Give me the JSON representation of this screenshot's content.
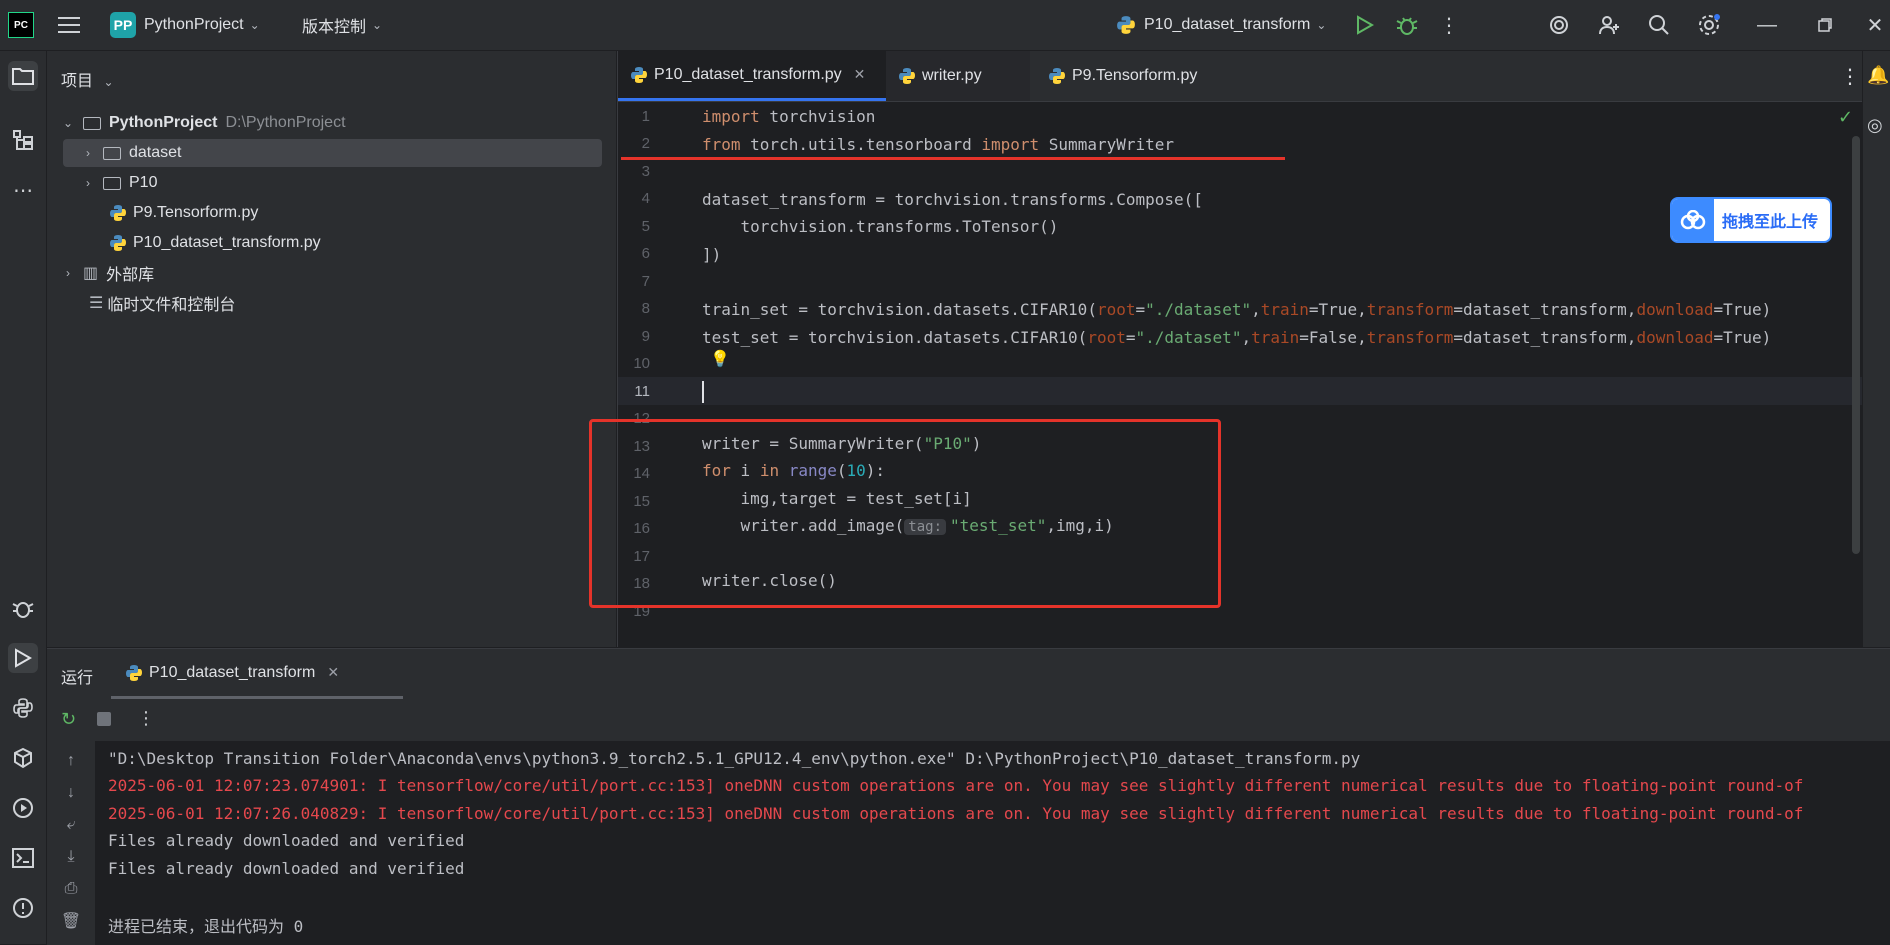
{
  "titlebar": {
    "project_badge": "PP",
    "project_name": "PythonProject",
    "vcs_label": "版本控制",
    "run_config": "P10_dataset_transform"
  },
  "project_panel": {
    "header": "项目",
    "root_name": "PythonProject",
    "root_path": "D:\\PythonProject",
    "items": [
      {
        "label": "dataset",
        "kind": "folder"
      },
      {
        "label": "P10",
        "kind": "folder"
      },
      {
        "label": "P9.Tensorform.py",
        "kind": "python"
      },
      {
        "label": "P10_dataset_transform.py",
        "kind": "python"
      }
    ],
    "external_libs": "外部库",
    "scratches": "临时文件和控制台"
  },
  "editor": {
    "tabs": [
      {
        "label": "P10_dataset_transform.py",
        "active": true
      },
      {
        "label": "writer.py",
        "active": false
      },
      {
        "label": "P9.Tensorform.py",
        "active": false
      }
    ],
    "line_numbers": [
      "1",
      "2",
      "3",
      "4",
      "5",
      "6",
      "7",
      "8",
      "9",
      "10",
      "11",
      "12",
      "13",
      "14",
      "15",
      "16",
      "17",
      "18",
      "19"
    ],
    "current_line": "11",
    "code": {
      "l1_kw": "import",
      "l1_rest": " torchvision",
      "l2_kw1": "from",
      "l2_mid": " torch.utils.tensorboard ",
      "l2_kw2": "import",
      "l2_rest": " SummaryWriter",
      "l4": "dataset_transform = torchvision.transforms.Compose([",
      "l5": "    torchvision.transforms.ToTensor()",
      "l6": "])",
      "l8_a": "train_set = torchvision.datasets.CIFAR10(",
      "l8_p1": "root",
      "l8_s1": "\"./dataset\"",
      "l8_c1": ",",
      "l8_p2": "train",
      "l8_v2": "=True,",
      "l8_p3": "transform",
      "l8_v3": "=dataset_transform,",
      "l8_p4": "download",
      "l8_v4": "=True)",
      "l9_a": "test_set = torchvision.datasets.CIFAR10(",
      "l9_p1": "root",
      "l9_s1": "\"./dataset\"",
      "l9_c1": ",",
      "l9_p2": "train",
      "l9_v2": "=False,",
      "l9_p3": "transform",
      "l9_v3": "=dataset_transform,",
      "l9_p4": "download",
      "l9_v4": "=True)",
      "l13_a": "writer = SummaryWriter(",
      "l13_s": "\"P10\"",
      "l13_b": ")",
      "l14_kw1": "for",
      "l14_mid": " i ",
      "l14_kw2": "in",
      "l14_sp": " ",
      "l14_bi": "range",
      "l14_lp": "(",
      "l14_num": "10",
      "l14_rp": "):",
      "l15": "    img,target = test_set[i]",
      "l16_a": "    writer.add_image(",
      "l16_hint": "tag:",
      "l16_s": "\"test_set\"",
      "l16_b": ",img,i)",
      "l18": "writer.close()"
    }
  },
  "upload_widget": {
    "label": "拖拽至此上传"
  },
  "run_panel": {
    "tab_run": "运行",
    "tab_config": "P10_dataset_transform",
    "lines": [
      {
        "text": "\"D:\\Desktop Transition Folder\\Anaconda\\envs\\python3.9_torch2.5.1_GPU12.4_env\\python.exe\" D:\\PythonProject\\P10_dataset_transform.py",
        "error": false
      },
      {
        "text": "2025-06-01 12:07:23.074901: I tensorflow/core/util/port.cc:153] oneDNN custom operations are on. You may see slightly different numerical results due to floating-point round-of",
        "error": true
      },
      {
        "text": "2025-06-01 12:07:26.040829: I tensorflow/core/util/port.cc:153] oneDNN custom operations are on. You may see slightly different numerical results due to floating-point round-of",
        "error": true
      },
      {
        "text": "Files already downloaded and verified",
        "error": false
      },
      {
        "text": "Files already downloaded and verified",
        "error": false
      },
      {
        "text": "",
        "error": false
      },
      {
        "text": "进程已结束，退出代码为 0",
        "error": false
      }
    ]
  },
  "colors": {
    "accent": "#3574f0",
    "annotation_red": "#e5332a",
    "error_red": "#e5484d"
  }
}
